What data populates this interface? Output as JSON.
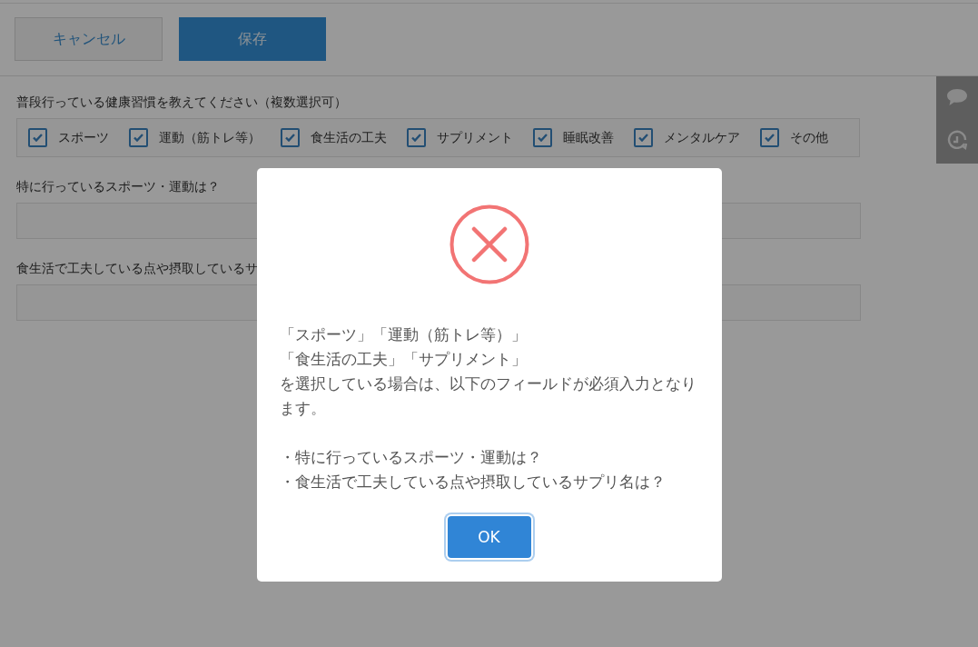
{
  "toolbar": {
    "buttons": [
      {
        "label": "キャンセル",
        "kind": "secondary"
      },
      {
        "label": "保存",
        "kind": "primary"
      }
    ]
  },
  "habits": {
    "label": "普段行っている健康習慣を教えてください（複数選択可）",
    "options": [
      {
        "label": "スポーツ",
        "checked": true
      },
      {
        "label": "運動（筋トレ等）",
        "checked": true
      },
      {
        "label": "食生活の工夫",
        "checked": true
      },
      {
        "label": "サプリメント",
        "checked": true
      },
      {
        "label": "睡眠改善",
        "checked": true
      },
      {
        "label": "メンタルケア",
        "checked": true
      },
      {
        "label": "その他",
        "checked": true
      }
    ]
  },
  "fields": [
    {
      "label": "特に行っているスポーツ・運動は？"
    },
    {
      "label": "食生活で工夫している点や摂取しているサ"
    }
  ],
  "dialog": {
    "kind": "error",
    "lines": [
      "「スポーツ」「運動（筋トレ等）」",
      "「食生活の工夫」「サプリメント」",
      "を選択している場合は、以下のフィールドが必須入力となります。"
    ],
    "bullets": [
      "・特に行っているスポーツ・運動は？",
      "・食生活で工夫している点や摂取しているサプリ名は？"
    ],
    "button": "OK"
  }
}
